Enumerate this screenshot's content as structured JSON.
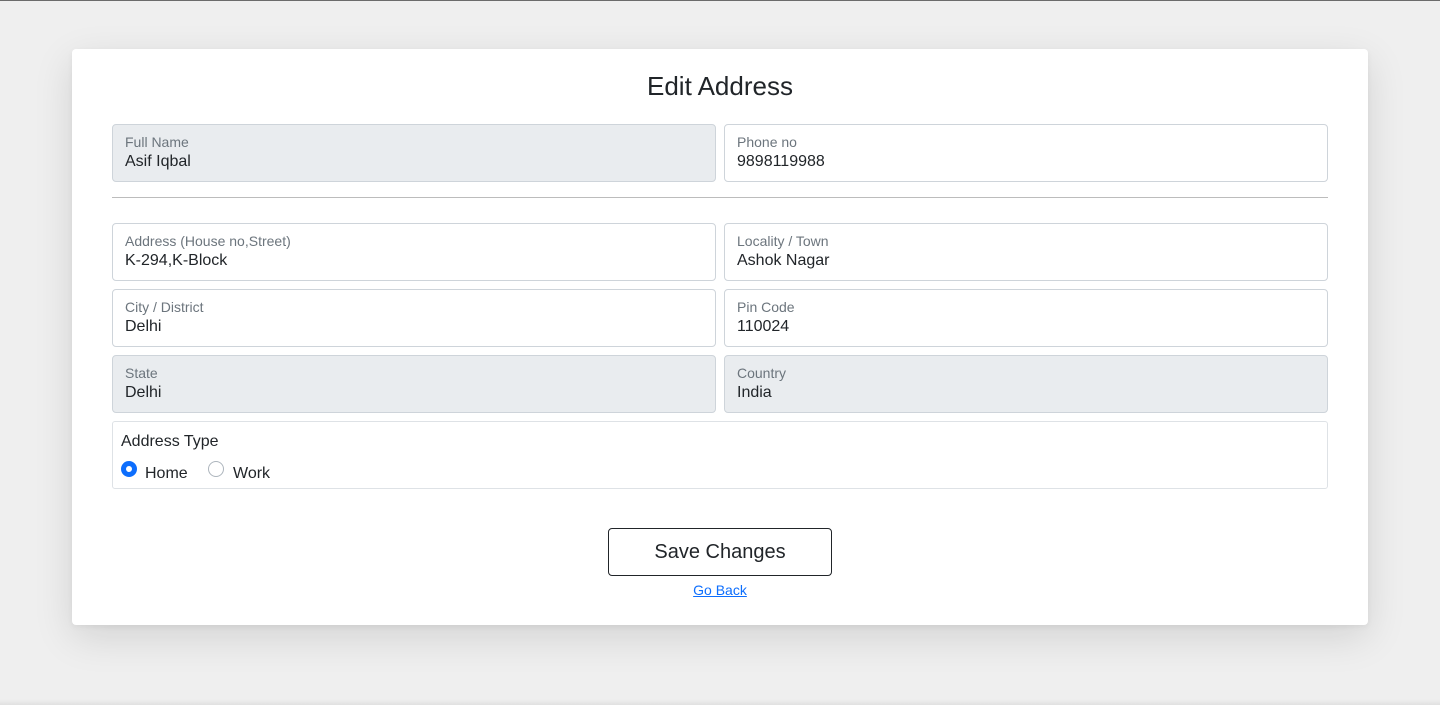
{
  "page": {
    "title": "Edit Address"
  },
  "form": {
    "full_name": {
      "label": "Full Name",
      "value": "Asif Iqbal"
    },
    "phone": {
      "label": "Phone no",
      "value": "9898119988"
    },
    "address": {
      "label": "Address (House no,Street)",
      "value": "K-294,K-Block"
    },
    "locality": {
      "label": "Locality / Town",
      "value": "Ashok Nagar"
    },
    "city": {
      "label": "City / District",
      "value": "Delhi"
    },
    "pincode": {
      "label": "Pin Code",
      "value": "110024"
    },
    "state": {
      "label": "State",
      "value": "Delhi"
    },
    "country": {
      "label": "Country",
      "value": "India"
    }
  },
  "address_type": {
    "legend": "Address Type",
    "options": [
      {
        "label": "Home",
        "selected": true
      },
      {
        "label": "Work",
        "selected": false
      }
    ]
  },
  "actions": {
    "save_label": "Save Changes",
    "back_label": "Go Back"
  },
  "colors": {
    "accent": "#0d6efd",
    "disabled_bg": "#e9ecef",
    "page_bg": "#efefef"
  }
}
